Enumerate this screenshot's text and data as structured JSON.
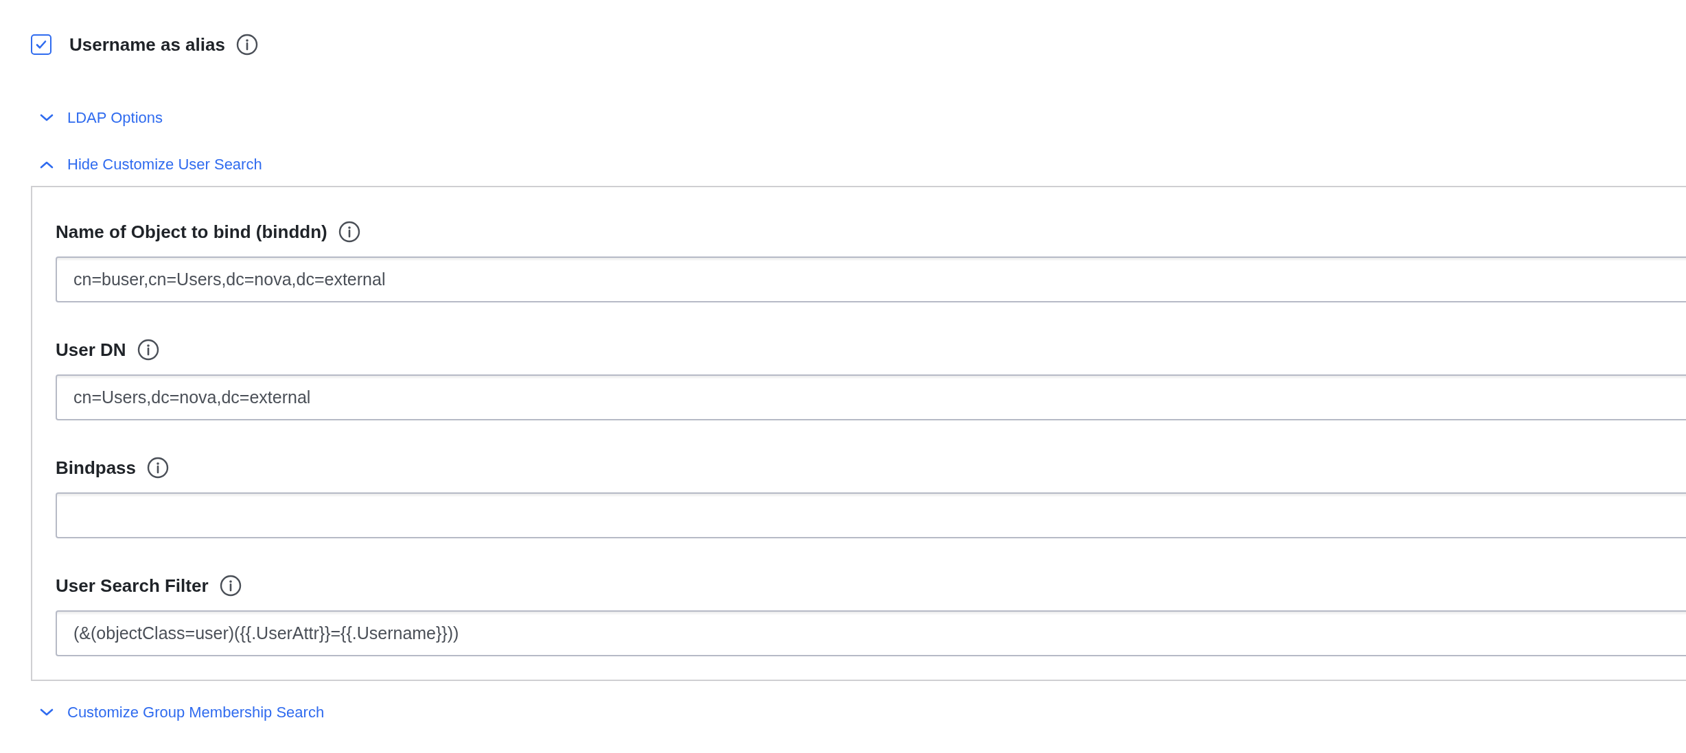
{
  "alias_option": {
    "label": "Username as alias",
    "checked": true
  },
  "sections": [
    {
      "title": "LDAP Options",
      "expanded": false
    },
    {
      "title": "Hide Customize User Search",
      "expanded": true,
      "fields": [
        {
          "label": "Name of Object to bind (binddn)",
          "value": "cn=buser,cn=Users,dc=nova,dc=external"
        },
        {
          "label": "User DN",
          "value": "cn=Users,dc=nova,dc=external"
        },
        {
          "label": "Bindpass"
        },
        {
          "label": "User Search Filter",
          "value": "(&(objectClass=user)({{.UserAttr}}={{.Username}}))"
        }
      ]
    },
    {
      "title": "Customize Group Membership Search",
      "expanded": false
    }
  ]
}
